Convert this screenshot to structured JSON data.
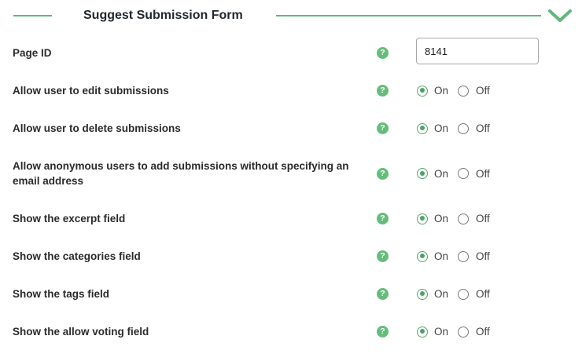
{
  "section": {
    "title": "Suggest Submission Form"
  },
  "colors": {
    "accent": "#5fb77a",
    "help_badge": "#65bd7b",
    "radio_checked": "#4ba464"
  },
  "icons": {
    "collapse": "chevron-down-icon",
    "help": "question-icon"
  },
  "page_id": {
    "label": "Page ID",
    "value": "8141",
    "help": "?"
  },
  "options": [
    {
      "label": "Allow user to edit submissions",
      "help": "?",
      "on_label": "On",
      "off_label": "Off",
      "selected": "On"
    },
    {
      "label": "Allow user to delete submissions",
      "help": "?",
      "on_label": "On",
      "off_label": "Off",
      "selected": "On"
    },
    {
      "label": "Allow anonymous users to add submissions without specifying an email address",
      "help": "?",
      "on_label": "On",
      "off_label": "Off",
      "selected": "On"
    },
    {
      "label": "Show the excerpt field",
      "help": "?",
      "on_label": "On",
      "off_label": "Off",
      "selected": "On"
    },
    {
      "label": "Show the categories field",
      "help": "?",
      "on_label": "On",
      "off_label": "Off",
      "selected": "On"
    },
    {
      "label": "Show the tags field",
      "help": "?",
      "on_label": "On",
      "off_label": "Off",
      "selected": "On"
    },
    {
      "label": "Show the allow voting field",
      "help": "?",
      "on_label": "On",
      "off_label": "Off",
      "selected": "On"
    }
  ]
}
